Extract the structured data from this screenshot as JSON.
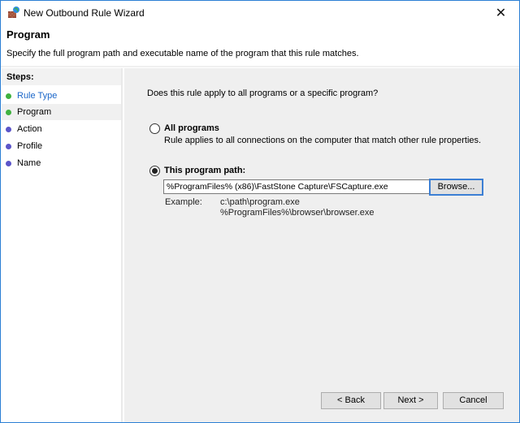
{
  "window": {
    "title": "New Outbound Rule Wizard",
    "close_label": "✕"
  },
  "header": {
    "title": "Program",
    "description": "Specify the full program path and executable name of the program that this rule matches."
  },
  "steps": {
    "heading": "Steps:",
    "items": [
      {
        "label": "Rule Type",
        "state": "done",
        "color": "#1a66c9",
        "dot": "#3fb13f"
      },
      {
        "label": "Program",
        "state": "current",
        "color": "#000000",
        "dot": "#3fb13f"
      },
      {
        "label": "Action",
        "state": "pending",
        "color": "#000000",
        "dot": "#5b55c9"
      },
      {
        "label": "Profile",
        "state": "pending",
        "color": "#000000",
        "dot": "#5b55c9"
      },
      {
        "label": "Name",
        "state": "pending",
        "color": "#000000",
        "dot": "#5b55c9"
      }
    ]
  },
  "main": {
    "question": "Does this rule apply to all programs or a specific program?",
    "options": [
      {
        "label": "All programs",
        "description": "Rule applies to all connections on the computer that match other rule properties.",
        "selected": false
      },
      {
        "label": "This program path:",
        "selected": true
      }
    ],
    "path_value": "%ProgramFiles% (x86)\\FastStone Capture\\FSCapture.exe",
    "browse_label": "Browse...",
    "example_label": "Example:",
    "example_lines": [
      "c:\\path\\program.exe",
      "%ProgramFiles%\\browser\\browser.exe"
    ]
  },
  "footer": {
    "back_label": "< Back",
    "next_label": "Next >",
    "cancel_label": "Cancel"
  }
}
